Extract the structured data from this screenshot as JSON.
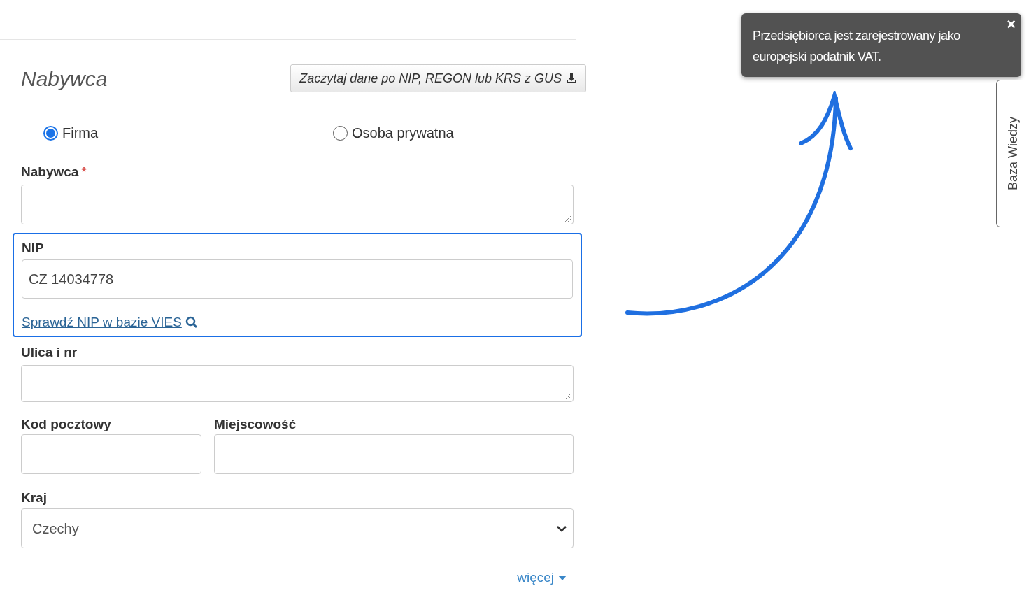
{
  "header": {
    "title": "Nabywca",
    "gus_button": "Zaczytaj dane po NIP, REGON lub KRS z GUS"
  },
  "buyer_type": [
    {
      "label": "Firma",
      "selected": true
    },
    {
      "label": "Osoba prywatna",
      "selected": false
    }
  ],
  "buyer_field": {
    "label": "Nabywca",
    "required_mark": "*"
  },
  "nip": {
    "label": "NIP",
    "value": "CZ 14034778",
    "link": "Sprawdź NIP w bazie VIES",
    "highlighted": true
  },
  "street": {
    "label": "Ulica i nr"
  },
  "postal_code": {
    "label": "Kod pocztowy"
  },
  "city": {
    "label": "Miejscowość"
  },
  "country": {
    "label": "Kraj",
    "value": "Czechy"
  },
  "more_link": "więcej",
  "toast": {
    "message": "Przedsiębiorca jest zarejestrowany jako europejski podatnik VAT.",
    "close": "×"
  },
  "side_tab": "Baza Wiedzy"
}
